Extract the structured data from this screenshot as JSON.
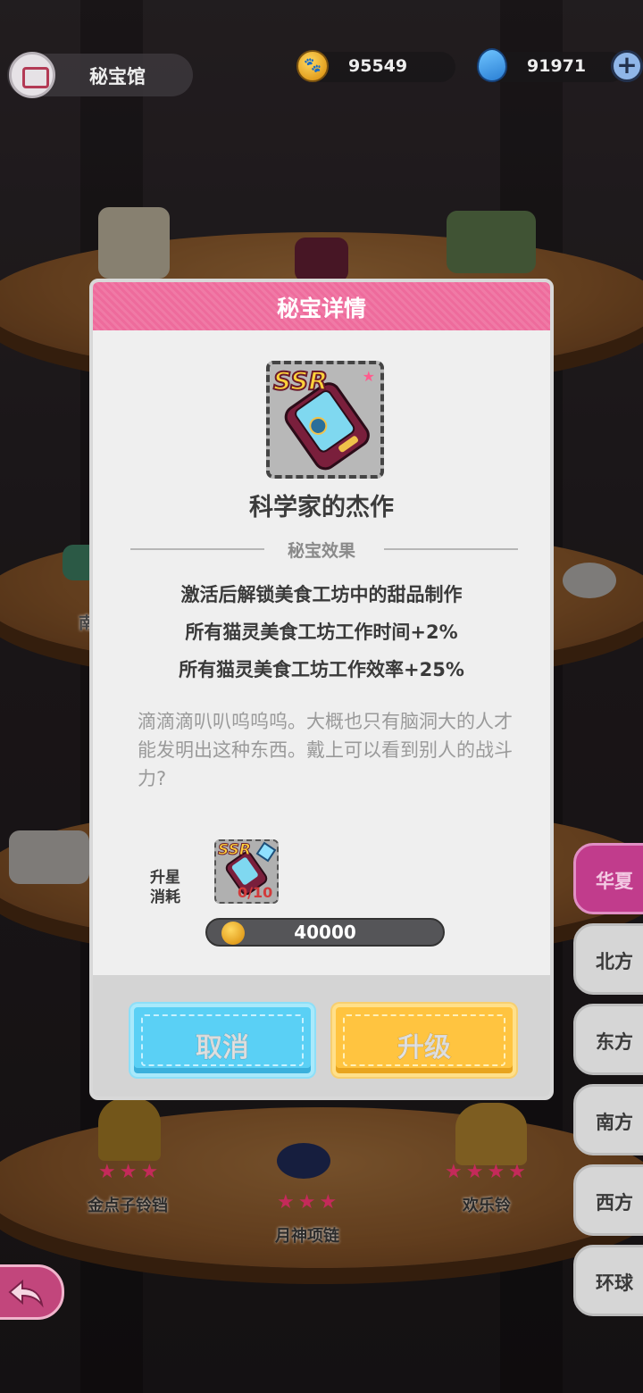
{
  "header": {
    "title": "秘宝馆",
    "coins": "95549",
    "gems": "91971",
    "plus_icon": "plus-icon"
  },
  "regions": [
    {
      "label": "华夏",
      "active": true
    },
    {
      "label": "北方",
      "active": false
    },
    {
      "label": "东方",
      "active": false
    },
    {
      "label": "南方",
      "active": false
    },
    {
      "label": "西方",
      "active": false
    },
    {
      "label": "环球",
      "active": false
    }
  ],
  "shelf": {
    "item_left_label": "金点子铃铛",
    "item_mid_label": "月神项链",
    "item_right_label": "欢乐铃",
    "partial_label": "南"
  },
  "dialog": {
    "title": "秘宝详情",
    "rarity": "SSR",
    "item_name": "科学家的杰作",
    "section_label": "秘宝效果",
    "effects": [
      "激活后解锁美食工坊中的甜品制作",
      "所有猫灵美食工坊工作时间+2%",
      "所有猫灵美食工坊工作效率+25%"
    ],
    "description": "滴滴滴叭叭呜呜呜。大概也只有脑洞大的人才能发明出这种东西。戴上可以看到别人的战斗力?",
    "upgrade_label_line1": "升星",
    "upgrade_label_line2": "消耗",
    "shard_rarity": "SSR",
    "shard_count": "0/10",
    "cost": "40000",
    "cancel_label": "取消",
    "upgrade_label": "升级"
  },
  "colors": {
    "header_pink": "#ee6b9c",
    "cancel_blue": "#5ad0f5",
    "upgrade_yellow": "#ffc440",
    "active_tab": "#c13c8c"
  }
}
